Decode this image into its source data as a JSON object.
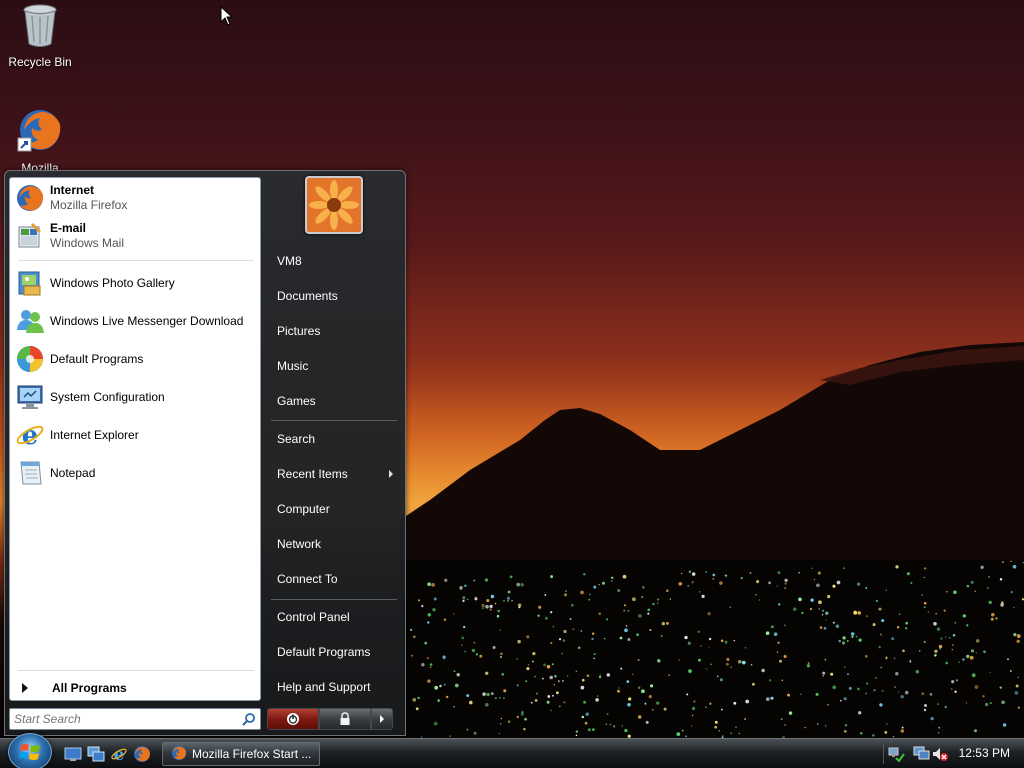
{
  "desktop": {
    "icons": [
      {
        "label": "Recycle Bin",
        "icon": "recycle-bin-icon"
      },
      {
        "label": "Mozilla",
        "icon": "firefox-shortcut-icon"
      }
    ]
  },
  "start_menu": {
    "pinned": [
      {
        "title": "Internet",
        "subtitle": "Mozilla Firefox",
        "icon": "firefox-icon"
      },
      {
        "title": "E-mail",
        "subtitle": "Windows Mail",
        "icon": "windows-mail-icon"
      }
    ],
    "recent": [
      {
        "label": "Windows Photo Gallery",
        "icon": "photo-gallery-icon"
      },
      {
        "label": "Windows Live Messenger Download",
        "icon": "messenger-icon"
      },
      {
        "label": "Default Programs",
        "icon": "default-programs-icon"
      },
      {
        "label": "System Configuration",
        "icon": "system-configuration-icon"
      },
      {
        "label": "Internet Explorer",
        "icon": "internet-explorer-icon"
      },
      {
        "label": "Notepad",
        "icon": "notepad-icon"
      }
    ],
    "all_programs": "All Programs",
    "search_placeholder": "Start Search",
    "right": {
      "user": "VM8",
      "items_group1": [
        "Documents",
        "Pictures",
        "Music",
        "Games"
      ],
      "items_group2": [
        "Search",
        "Recent Items",
        "Computer",
        "Network",
        "Connect To"
      ],
      "items_group3": [
        "Control Panel",
        "Default Programs",
        "Help and Support"
      ]
    }
  },
  "taskbar": {
    "task_label": "Mozilla Firefox Start ...",
    "clock": "12:53 PM",
    "quick_launch": [
      "show-desktop-icon",
      "switch-windows-icon",
      "internet-explorer-icon",
      "firefox-icon"
    ],
    "tray": [
      "network-icon",
      "display-icon",
      "volume-muted-icon"
    ]
  },
  "colors": {
    "menu_bg": "#1e2124",
    "left_pane_bg": "#ffffff",
    "power_red": "#a33324"
  }
}
